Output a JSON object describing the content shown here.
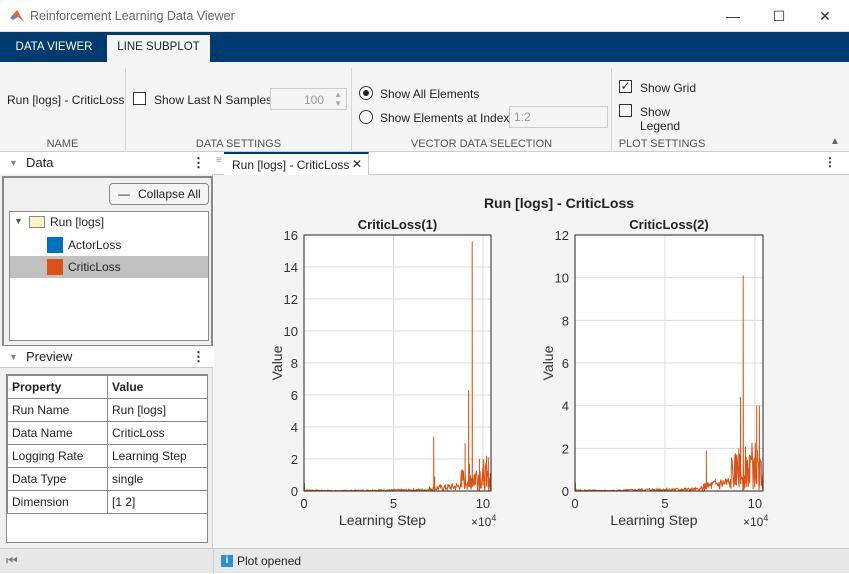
{
  "window": {
    "title": "Reinforcement Learning Data Viewer",
    "minimize": "—",
    "maximize": "☐",
    "close": "✕"
  },
  "ribbon": {
    "tabs": [
      {
        "label": "DATA VIEWER"
      },
      {
        "label": "LINE SUBPLOT"
      }
    ],
    "name": {
      "value": "Run [logs] - CriticLoss",
      "section": "NAME"
    },
    "data_settings": {
      "show_last_n_label": "Show Last N Samples",
      "show_last_n_checked": false,
      "n_value": "100",
      "section": "DATA SETTINGS"
    },
    "vector": {
      "show_all_label": "Show All Elements",
      "show_index_label": "Show Elements at Index",
      "index_value": "1:2",
      "selected": "all",
      "section": "VECTOR DATA SELECTION"
    },
    "plot_settings": {
      "show_grid_label": "Show Grid",
      "show_grid_checked": true,
      "show_legend_label": "Show Legend",
      "show_legend_checked": false,
      "section": "PLOT SETTINGS"
    }
  },
  "data_panel": {
    "title": "Data",
    "collapse_label": "Collapse All",
    "tree": {
      "root": "Run [logs]",
      "items": [
        {
          "label": "ActorLoss",
          "color": "#0072bd"
        },
        {
          "label": "CriticLoss",
          "color": "#d95319",
          "selected": true
        }
      ]
    }
  },
  "preview": {
    "title": "Preview",
    "headers": [
      "Property",
      "Value"
    ],
    "rows": [
      [
        "Run Name",
        "Run [logs]"
      ],
      [
        "Data Name",
        "CriticLoss"
      ],
      [
        "Logging Rate",
        "Learning Step"
      ],
      [
        "Data Type",
        "single"
      ],
      [
        "Dimension",
        "[1 2]"
      ]
    ]
  },
  "doc_tab": {
    "label": "Run [logs] - CriticLoss"
  },
  "status": {
    "text": "Plot opened"
  },
  "chart_data": [
    {
      "type": "line",
      "suptitle": "Run [logs] - CriticLoss",
      "title": "CriticLoss(1)",
      "xlabel": "Learning Step",
      "ylabel": "Value",
      "x_exponent": "×10",
      "x_exponent_power": "4",
      "xlim": [
        0,
        10.45
      ],
      "ylim": [
        0,
        16
      ],
      "xticks": [
        0,
        5,
        10
      ],
      "yticks": [
        0,
        2,
        4,
        6,
        8,
        10,
        12,
        14,
        16
      ],
      "grid": true,
      "color": "#d95319",
      "baseline": [
        [
          0,
          0.08
        ],
        [
          2,
          0.03
        ],
        [
          4,
          0.08
        ],
        [
          6,
          0.1
        ],
        [
          7,
          0.12
        ],
        [
          8,
          0.18
        ],
        [
          9,
          0.25
        ],
        [
          10,
          0.35
        ],
        [
          10.45,
          0.2
        ]
      ],
      "spikes": [
        [
          0.02,
          0.5
        ],
        [
          7.25,
          3.4
        ],
        [
          7.3,
          0.9
        ],
        [
          8.8,
          0.7
        ],
        [
          9.0,
          3.0
        ],
        [
          9.2,
          6.3
        ],
        [
          9.25,
          1.7
        ],
        [
          9.4,
          15.6
        ],
        [
          9.5,
          1.0
        ],
        [
          9.8,
          2.0
        ],
        [
          10.0,
          1.5
        ],
        [
          10.2,
          2.2
        ],
        [
          10.3,
          2.1
        ],
        [
          10.4,
          1.1
        ]
      ]
    },
    {
      "type": "line",
      "title": "CriticLoss(2)",
      "xlabel": "Learning Step",
      "ylabel": "Value",
      "x_exponent": "×10",
      "x_exponent_power": "4",
      "xlim": [
        0,
        10.45
      ],
      "ylim": [
        0,
        12
      ],
      "xticks": [
        0,
        5,
        10
      ],
      "yticks": [
        0,
        2,
        4,
        6,
        8,
        10,
        12
      ],
      "grid": true,
      "color": "#d95319",
      "baseline": [
        [
          0,
          0.06
        ],
        [
          2,
          0.03
        ],
        [
          4,
          0.1
        ],
        [
          6,
          0.12
        ],
        [
          7,
          0.12
        ],
        [
          8,
          0.25
        ],
        [
          9,
          0.3
        ],
        [
          10,
          0.4
        ],
        [
          10.45,
          0.2
        ]
      ],
      "spikes": [
        [
          0.02,
          0.4
        ],
        [
          7.3,
          1.9
        ],
        [
          8.9,
          1.6
        ],
        [
          9.1,
          2.0
        ],
        [
          9.2,
          4.4
        ],
        [
          9.35,
          10.1
        ],
        [
          9.5,
          1.3
        ],
        [
          9.7,
          1.7
        ],
        [
          9.9,
          1.3
        ],
        [
          10.1,
          4.0
        ],
        [
          10.25,
          4.0
        ],
        [
          10.35,
          1.4
        ]
      ]
    }
  ]
}
